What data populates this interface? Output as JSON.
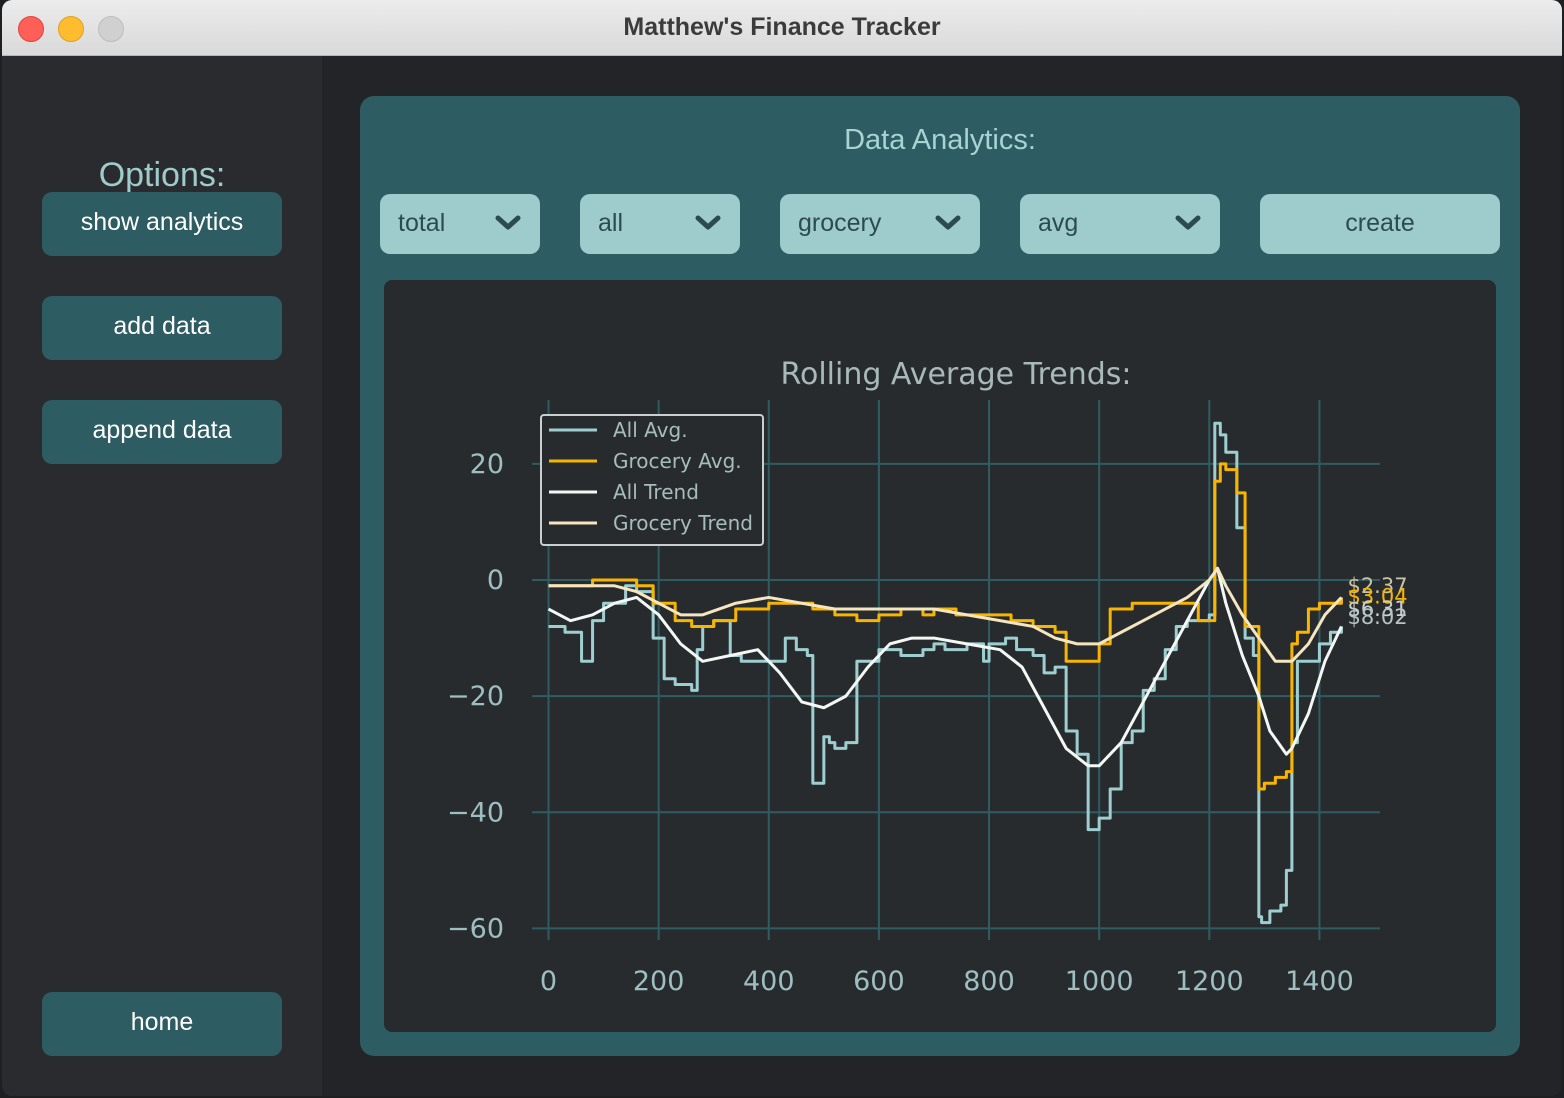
{
  "window": {
    "title": "Matthew's Finance Tracker"
  },
  "sidebar": {
    "heading": "Options:",
    "buttons": {
      "show_analytics": "show analytics",
      "add_data": "add data",
      "append_data": "append data",
      "home": "home"
    }
  },
  "analytics": {
    "heading": "Data Analytics:",
    "dropdowns": [
      "total",
      "all",
      "grocery",
      "avg"
    ],
    "create_label": "create"
  },
  "colors": {
    "all_avg": "#9ecfd0",
    "grocery_avg": "#f7b500",
    "all_trend": "#f4f8f5",
    "grocery_trend": "#f5e6c0"
  },
  "chart_data": {
    "type": "line",
    "title": "Rolling Average Trends:",
    "xlabel": "",
    "ylabel": "",
    "xlim": [
      -30,
      1510
    ],
    "ylim": [
      -62,
      31
    ],
    "xticks": [
      0,
      200,
      400,
      600,
      800,
      1000,
      1200,
      1400
    ],
    "yticks": [
      20,
      0,
      -20,
      -40,
      -60
    ],
    "grid": true,
    "legend_position": "top-left",
    "series": [
      {
        "name": "All Avg.",
        "x": [
          0,
          30,
          60,
          80,
          100,
          140,
          160,
          190,
          210,
          230,
          260,
          270,
          280,
          300,
          330,
          350,
          380,
          400,
          430,
          450,
          470,
          480,
          490,
          500,
          510,
          520,
          540,
          560,
          580,
          600,
          640,
          680,
          700,
          720,
          760,
          790,
          800,
          830,
          850,
          880,
          900,
          920,
          940,
          960,
          980,
          1000,
          1020,
          1040,
          1060,
          1080,
          1100,
          1120,
          1140,
          1160,
          1180,
          1200,
          1210,
          1220,
          1230,
          1250,
          1265,
          1280,
          1290,
          1295,
          1310,
          1330,
          1340,
          1350,
          1360,
          1380,
          1400,
          1420,
          1440
        ],
        "y": [
          -8,
          -9,
          -14,
          -7,
          -4,
          -1,
          -2,
          -10,
          -17,
          -18,
          -19,
          -12,
          -8,
          -7,
          -13,
          -14,
          -14,
          -14,
          -10,
          -12,
          -13,
          -35,
          -35,
          -27,
          -28,
          -29,
          -28,
          -14,
          -14,
          -12,
          -13,
          -12,
          -11,
          -12,
          -11,
          -14,
          -11,
          -10,
          -12,
          -13,
          -16,
          -15,
          -26,
          -30,
          -43,
          -41,
          -36,
          -28,
          -26,
          -19,
          -17,
          -12,
          -8,
          -7,
          -7,
          -6,
          27,
          25,
          22,
          9,
          -10,
          -13,
          -58,
          -59,
          -57,
          -56,
          -50,
          -28,
          -14,
          -14,
          -11,
          -9,
          -8
        ]
      },
      {
        "name": "Grocery Avg.",
        "x": [
          0,
          40,
          80,
          100,
          140,
          160,
          190,
          230,
          260,
          280,
          300,
          340,
          400,
          440,
          480,
          520,
          560,
          600,
          640,
          680,
          700,
          740,
          800,
          840,
          880,
          920,
          940,
          980,
          1000,
          1020,
          1060,
          1100,
          1140,
          1180,
          1200,
          1210,
          1220,
          1230,
          1250,
          1265,
          1280,
          1290,
          1300,
          1320,
          1340,
          1350,
          1360,
          1380,
          1400,
          1420,
          1440
        ],
        "y": [
          -1,
          -1,
          0,
          0,
          0,
          -1,
          -4,
          -7,
          -8,
          -8,
          -7,
          -5,
          -4,
          -4,
          -5,
          -6,
          -7,
          -6,
          -5,
          -6,
          -5,
          -6,
          -6,
          -7,
          -8,
          -9,
          -14,
          -14,
          -11,
          -5,
          -4,
          -4,
          -4,
          -7,
          -7,
          17,
          20,
          19,
          15,
          -8,
          -8,
          -36,
          -35,
          -34,
          -33,
          -11,
          -9,
          -5,
          -4,
          -4,
          -3
        ]
      },
      {
        "name": "All Trend",
        "x": [
          0,
          40,
          80,
          120,
          160,
          200,
          240,
          280,
          330,
          380,
          420,
          460,
          500,
          540,
          580,
          620,
          660,
          700,
          760,
          820,
          860,
          900,
          940,
          980,
          1000,
          1040,
          1080,
          1120,
          1160,
          1200,
          1215,
          1230,
          1260,
          1290,
          1310,
          1340,
          1350,
          1380,
          1410,
          1440
        ],
        "y": [
          -5,
          -7,
          -6,
          -4,
          -3,
          -6,
          -11,
          -14,
          -13,
          -12,
          -16,
          -21,
          -22,
          -20,
          -15,
          -11,
          -10,
          -10,
          -11,
          -12,
          -15,
          -22,
          -29,
          -32,
          -32,
          -28,
          -21,
          -14,
          -7,
          0,
          2,
          -4,
          -13,
          -20,
          -26,
          -30,
          -29,
          -23,
          -14,
          -8
        ]
      },
      {
        "name": "Grocery Trend",
        "x": [
          0,
          60,
          120,
          160,
          200,
          240,
          280,
          340,
          400,
          460,
          520,
          580,
          640,
          700,
          760,
          820,
          880,
          920,
          960,
          1000,
          1040,
          1080,
          1120,
          1160,
          1200,
          1215,
          1230,
          1260,
          1290,
          1320,
          1350,
          1380,
          1410,
          1440
        ],
        "y": [
          -1,
          -1,
          -1,
          -2,
          -4,
          -6,
          -6,
          -4,
          -3,
          -4,
          -5,
          -5,
          -5,
          -5,
          -6,
          -7,
          -8,
          -10,
          -11,
          -11,
          -9,
          -7,
          -5,
          -3,
          0,
          2,
          -1,
          -6,
          -10,
          -14,
          -14,
          -11,
          -6,
          -3
        ]
      }
    ],
    "end_labels": [
      {
        "text": "$2.37",
        "y": -1.0,
        "color": "#c8c3a6"
      },
      {
        "text": "$3.04",
        "y": -2.8,
        "color": "#f7b500"
      },
      {
        "text": "$6.31",
        "y": -5.0,
        "color": "#c7d1d0"
      },
      {
        "text": "$8.02",
        "y": -6.4,
        "color": "#b6c3c4"
      }
    ]
  }
}
